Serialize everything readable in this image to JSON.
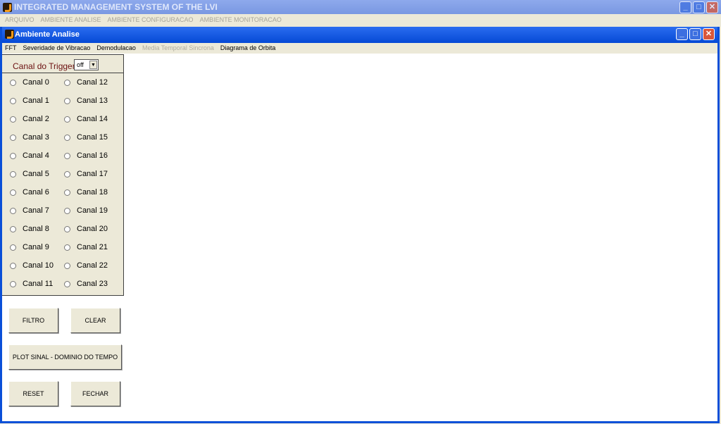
{
  "app": {
    "title": "INTEGRATED MANAGEMENT SYSTEM OF THE LVI",
    "menu": [
      "ARQUIVO",
      "AMBIENTE ANALISE",
      "AMBIENTE CONFIGURACAO",
      "AMBIENTE MONITORACAO"
    ]
  },
  "window": {
    "title": "Ambiente Analise",
    "menu": [
      {
        "label": "FFT",
        "enabled": true
      },
      {
        "label": "Severidade de Vibracao",
        "enabled": true
      },
      {
        "label": "Demodulacao",
        "enabled": true
      },
      {
        "label": "Media Temporal Sincrona",
        "enabled": false
      },
      {
        "label": "Diagrama de Orbita",
        "enabled": true
      }
    ]
  },
  "trigger": {
    "label": "Canal do Trigger",
    "value": "off"
  },
  "channels": [
    "Canal 0",
    "Canal 1",
    "Canal 2",
    "Canal 3",
    "Canal 4",
    "Canal 5",
    "Canal 6",
    "Canal 7",
    "Canal 8",
    "Canal 9",
    "Canal 10",
    "Canal 11",
    "Canal 12",
    "Canal 13",
    "Canal 14",
    "Canal 15",
    "Canal 16",
    "Canal 17",
    "Canal 18",
    "Canal 19",
    "Canal 20",
    "Canal 21",
    "Canal 22",
    "Canal 23"
  ],
  "buttons": {
    "filtro": "FILTRO",
    "clear": "CLEAR",
    "plot": "PLOT SINAL - DOMINIO DO TEMPO",
    "reset": "RESET",
    "fechar": "FECHAR"
  },
  "colors": {
    "active_title": "#0a4fd8",
    "inactive_title": "#7a98e2"
  }
}
